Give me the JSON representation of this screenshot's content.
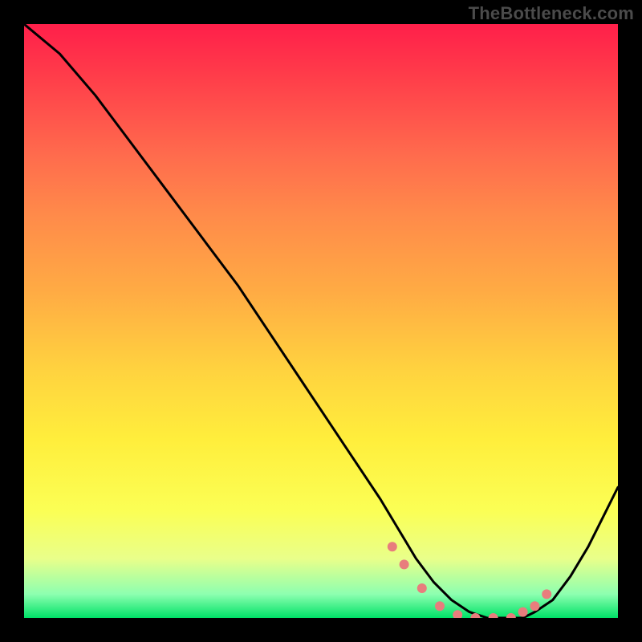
{
  "watermark": "TheBottleneck.com",
  "chart_data": {
    "type": "line",
    "title": "",
    "xlabel": "",
    "ylabel": "",
    "xlim": [
      0,
      100
    ],
    "ylim": [
      0,
      100
    ],
    "series": [
      {
        "name": "bottleneck-curve",
        "x": [
          0,
          6,
          12,
          18,
          24,
          30,
          36,
          42,
          48,
          54,
          60,
          63,
          66,
          69,
          72,
          75,
          78,
          81,
          84,
          86,
          89,
          92,
          95,
          98,
          100
        ],
        "y": [
          100,
          95,
          88,
          80,
          72,
          64,
          56,
          47,
          38,
          29,
          20,
          15,
          10,
          6,
          3,
          1,
          0,
          0,
          0,
          1,
          3,
          7,
          12,
          18,
          22
        ]
      }
    ],
    "optimal_markers": {
      "name": "ideal-range-dots",
      "x": [
        62,
        64,
        67,
        70,
        73,
        76,
        79,
        82,
        84,
        86,
        88
      ],
      "y": [
        12,
        9,
        5,
        2,
        0.5,
        0,
        0,
        0,
        1,
        2,
        4
      ]
    },
    "gradient_stops": [
      {
        "pos": 0.0,
        "color": "#ff1f4a"
      },
      {
        "pos": 0.45,
        "color": "#ffab44"
      },
      {
        "pos": 0.82,
        "color": "#fbff55"
      },
      {
        "pos": 1.0,
        "color": "#00e267"
      }
    ]
  }
}
